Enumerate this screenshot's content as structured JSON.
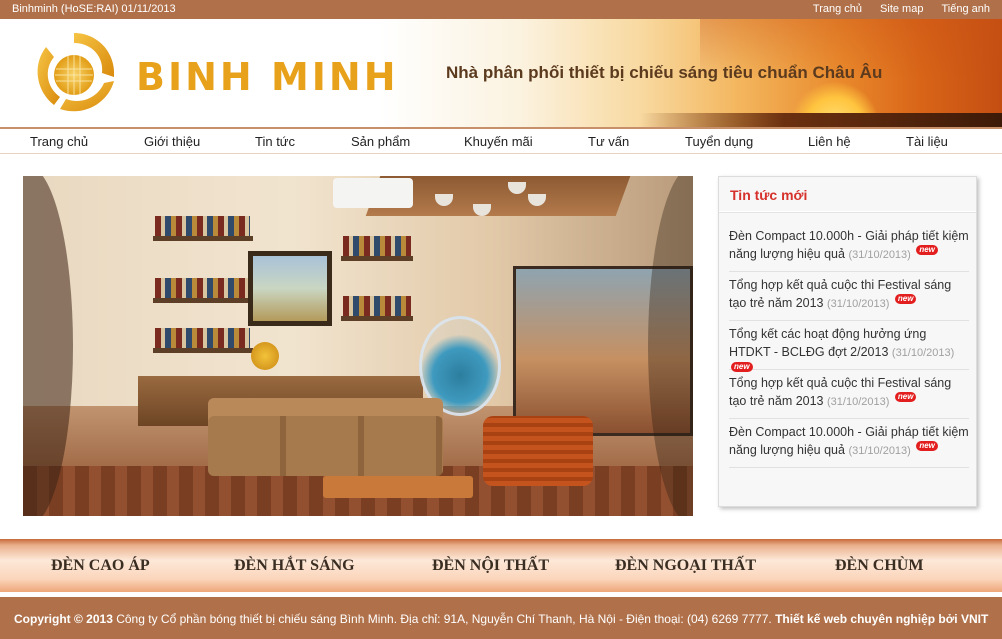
{
  "topbar": {
    "stock": "Binhminh (HoSE:RAI) 01/11/2013",
    "links": [
      "Trang chủ",
      "Site map",
      "Tiếng anh"
    ]
  },
  "brand": {
    "name": "BINH MINH",
    "tagline": "Nhà phân phối thiết bị chiếu sáng tiêu chuẩn Châu Âu"
  },
  "nav": [
    "Trang chủ",
    "Giới thiệu",
    "Tin tức",
    "Sản phẩm",
    "Khuyến mãi",
    "Tư vấn",
    "Tuyển dụng",
    "Liên hệ",
    "Tài liệu"
  ],
  "news": {
    "title": "Tin tức mới",
    "badge": "new",
    "items": [
      {
        "text": "Đèn Compact 10.000h - Giải pháp tiết kiệm năng lượng hiệu quả",
        "date": "(31/10/2013)"
      },
      {
        "text": "Tổng hợp kết quả cuộc thi Festival sáng tạo trẻ năm 2013",
        "date": "(31/10/2013)"
      },
      {
        "text": "Tổng kết các hoạt động hưởng ứng HTDKT - BCLĐG đợt 2/2013",
        "date": "(31/10/2013)"
      },
      {
        "text": "Tổng hợp kết quả cuộc thi Festival sáng tạo trẻ năm 2013",
        "date": "(31/10/2013)"
      },
      {
        "text": "Đèn Compact 10.000h - Giải pháp tiết kiệm năng lượng hiệu quả",
        "date": "(31/10/2013)"
      }
    ]
  },
  "categories": [
    "ĐÈN CAO ÁP",
    "ĐÈN HẮT SÁNG",
    "ĐÈN NỘI THẤT",
    "ĐÈN NGOẠI THẤT",
    "ĐÈN CHÙM"
  ],
  "footer": {
    "copyright": "Copyright © 2013",
    "info": " Công ty Cổ phần bóng thiết bị chiếu sáng Bình Minh. Địa chỉ: 91A, Nguyễn Chí Thanh, Hà Nội - Điện thoại: (04) 6269 7777. ",
    "credit": "Thiết kế web chuyên nghiệp bởi VNIT"
  },
  "colors": {
    "topbar": "#b0714a",
    "brand_gold": "#e8a11a",
    "news_title": "#d6312b",
    "footer": "#b0714a"
  }
}
